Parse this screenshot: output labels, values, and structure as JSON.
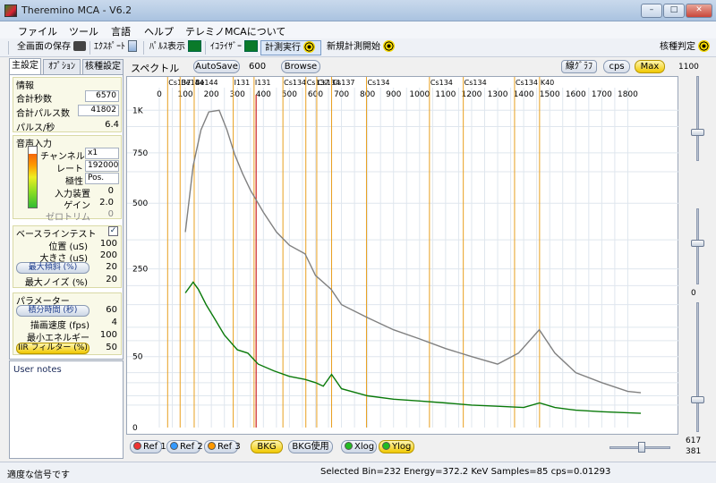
{
  "window": {
    "title": "Theremino MCA - V6.2",
    "min": "–",
    "max": "□",
    "close": "✕"
  },
  "menu": [
    "ファイル",
    "ツール",
    "言語",
    "ヘルプ",
    "テレミノMCAについて"
  ],
  "toolbar": {
    "save_all": "全画面の保存",
    "export": "ｴｸｽﾎﾟｰﾄ",
    "pulse_display": "ﾊﾟﾙｽ表示",
    "equalizer": "ｲｺﾗｲｻﾞｰ",
    "run": "計測実行",
    "new_measure": "新規計測開始",
    "nuclide_id": "核種判定"
  },
  "tabs": [
    "主設定",
    "ｵﾌﾟｼｮﾝ",
    "核種設定"
  ],
  "info": {
    "title": "情報",
    "total_seconds_label": "合計秒数",
    "total_seconds": "6570",
    "total_pulses_label": "合計パルス数",
    "total_pulses": "41802",
    "pulses_per_sec_label": "パルス/秒",
    "pulses_per_sec": "6.4"
  },
  "audio": {
    "title": "音声入力",
    "channel_label": "チャンネル",
    "channel": "x1",
    "rate_label": "レート",
    "rate": "192000",
    "polarity_label": "極性",
    "polarity": "Pos.",
    "input_device_label": "入力装置",
    "input_device": "0",
    "gain_label": "ゲイン",
    "gain": "2.0",
    "zero_trim_label": "ゼロトリム",
    "zero_trim": "0"
  },
  "baseline": {
    "title": "ベースラインテスト",
    "checked": "✓",
    "position_label": "位置 (uS)",
    "position": "100",
    "size_label": "大きさ (uS)",
    "size": "200",
    "max_slope_label": "最大傾斜 (%)",
    "max_slope": "20",
    "max_noise_label": "最大ノイズ (%)",
    "max_noise": "20"
  },
  "params": {
    "title": "パラメーター",
    "integration_label": "積分時間 (秒)",
    "integration": "60",
    "draw_speed_label": "描画速度 (fps)",
    "draw_speed": "4",
    "min_energy_label": "最小エネルギー",
    "min_energy": "100",
    "iir_label": "IIR フィルター (%)",
    "iir": "50"
  },
  "notes_label": "User notes",
  "spectrum": {
    "label": "スペクトル",
    "autosave": "AutoSave",
    "interval": "600",
    "browse": "Browse",
    "linear": "線ｸﾞﾗﾌ",
    "cps": "cps",
    "max": "Max",
    "ymax": "1100"
  },
  "slider_values": {
    "right_mid": "0",
    "bottom_a": "617",
    "bottom_b": "381"
  },
  "bottom": {
    "ref1": "Ref 1",
    "ref2": "Ref 2",
    "ref3": "Ref 3",
    "bkg": "BKG",
    "bkg_use": "BKG使用",
    "xlog": "Xlog",
    "ylog": "Ylog"
  },
  "status": {
    "left": "適度な信号です",
    "right": "Selected Bin=232  Energy=372.2 KeV  Samples=85  cps=0.01293"
  },
  "colors": {
    "gray_series": "#808080",
    "green_series": "#0a7a0a",
    "marker": "#e8a020",
    "cursor": "#cc2020"
  },
  "chart_data": {
    "type": "line",
    "x_ticks": [
      "0",
      "100",
      "200",
      "300",
      "400",
      "500",
      "600",
      "700",
      "800",
      "900",
      "1000",
      "1100",
      "1200",
      "1300",
      "1400",
      "1500",
      "1600",
      "1700",
      "1800"
    ],
    "y_ticks": [
      "0",
      "50",
      "250",
      "500",
      "750",
      "1K"
    ],
    "isotope_markers": [
      {
        "label": "Cs137",
        "energy": 32
      },
      {
        "label": "Be144",
        "energy": 80
      },
      {
        "label": "Be144",
        "energy": 134
      },
      {
        "label": "I131",
        "energy": 284
      },
      {
        "label": "I131",
        "energy": 364
      },
      {
        "label": "Cs134",
        "energy": 475
      },
      {
        "label": "Cs137",
        "energy": 563
      },
      {
        "label": "Cs134",
        "energy": 605
      },
      {
        "label": "Cs137",
        "energy": 662
      },
      {
        "label": "Cs134",
        "energy": 796
      },
      {
        "label": "Cs134",
        "energy": 1038
      },
      {
        "label": "Cs134",
        "energy": 1168
      },
      {
        "label": "Cs134",
        "energy": 1365
      },
      {
        "label": "K40",
        "energy": 1461
      }
    ],
    "cursor_energy": 372,
    "series": [
      {
        "points": [
          [
            100,
            380
          ],
          [
            130,
            680
          ],
          [
            160,
            880
          ],
          [
            190,
            990
          ],
          [
            230,
            1000
          ],
          [
            260,
            880
          ],
          [
            290,
            740
          ],
          [
            320,
            640
          ],
          [
            350,
            560
          ],
          [
            400,
            460
          ],
          [
            450,
            380
          ],
          [
            500,
            330
          ],
          [
            560,
            300
          ],
          [
            600,
            230
          ],
          [
            660,
            190
          ],
          [
            700,
            150
          ],
          [
            800,
            120
          ],
          [
            900,
            95
          ],
          [
            1000,
            78
          ],
          [
            1100,
            62
          ],
          [
            1200,
            50
          ],
          [
            1300,
            40
          ],
          [
            1380,
            55
          ],
          [
            1460,
            95
          ],
          [
            1520,
            55
          ],
          [
            1600,
            30
          ],
          [
            1700,
            20
          ],
          [
            1800,
            13
          ],
          [
            1850,
            12
          ]
        ]
      },
      {
        "points": [
          [
            100,
            180
          ],
          [
            130,
            210
          ],
          [
            150,
            190
          ],
          [
            180,
            150
          ],
          [
            210,
            120
          ],
          [
            250,
            85
          ],
          [
            300,
            60
          ],
          [
            340,
            55
          ],
          [
            380,
            40
          ],
          [
            440,
            32
          ],
          [
            500,
            26
          ],
          [
            560,
            23
          ],
          [
            600,
            20
          ],
          [
            630,
            17
          ],
          [
            662,
            28
          ],
          [
            700,
            15
          ],
          [
            800,
            10
          ],
          [
            900,
            8
          ],
          [
            1000,
            7
          ],
          [
            1100,
            6
          ],
          [
            1200,
            5
          ],
          [
            1300,
            4.5
          ],
          [
            1400,
            4
          ],
          [
            1461,
            6
          ],
          [
            1520,
            4
          ],
          [
            1600,
            3
          ],
          [
            1700,
            2.5
          ],
          [
            1850,
            2
          ]
        ]
      }
    ]
  }
}
